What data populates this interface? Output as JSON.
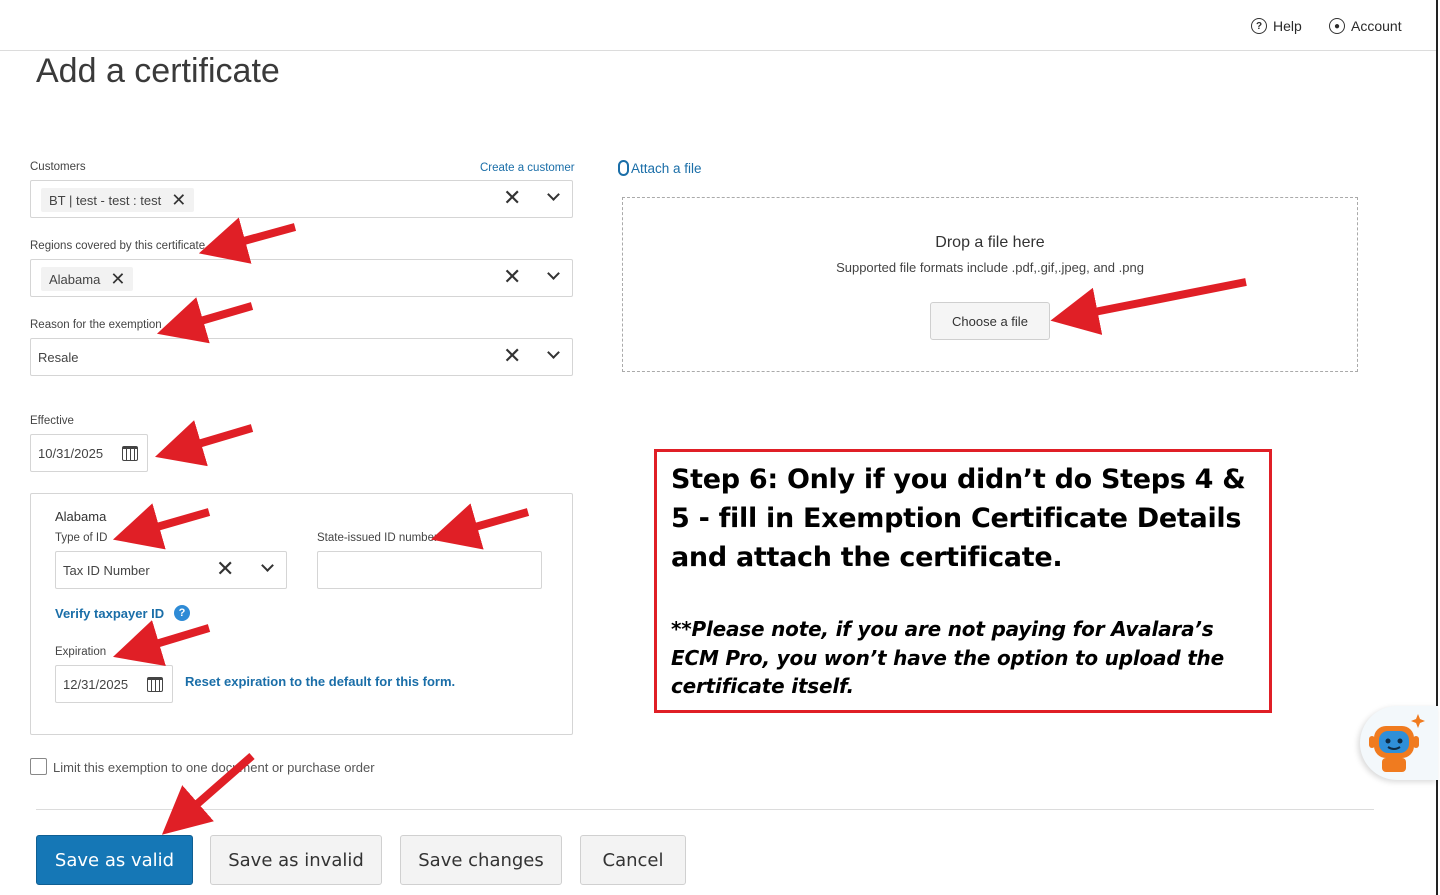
{
  "header": {
    "help_label": "Help",
    "account_label": "Account"
  },
  "page": {
    "title": "Add a certificate"
  },
  "form": {
    "customers_label": "Customers",
    "create_customer_link": "Create a customer",
    "customer_chip": "BT | test - test : test",
    "regions_label": "Regions covered by this certificate",
    "region_chip": "Alabama",
    "reason_label": "Reason for the exemption",
    "reason_value": "Resale",
    "effective_label": "Effective",
    "effective_value": "10/31/2025",
    "state_section": {
      "heading": "Alabama",
      "type_of_id_label": "Type of ID",
      "type_of_id_value": "Tax ID Number",
      "state_id_label": "State-issued ID number",
      "state_id_value": "",
      "verify_link": "Verify taxpayer ID",
      "expiration_label": "Expiration",
      "expiration_value": "12/31/2025",
      "reset_link": "Reset expiration to the default for this form."
    },
    "limit_checkbox_label": "Limit this exemption to one document or purchase order",
    "limit_checked": false
  },
  "attachment": {
    "attach_link": "Attach a file",
    "drop_title": "Drop a file here",
    "drop_sub": "Supported file formats include .pdf,.gif,.jpeg, and .png",
    "choose_button": "Choose a file"
  },
  "actions": {
    "save_valid": "Save as valid",
    "save_invalid": "Save as invalid",
    "save_changes": "Save changes",
    "cancel": "Cancel"
  },
  "callout": {
    "title": "Step 6: Only if you didn’t do Steps 4 & 5 - fill in Exemption Certificate Details and attach the certificate.",
    "note": "**Please note, if you are not paying for Avalara’s ECM Pro, you won’t have the option to upload the certificate itself."
  },
  "colors": {
    "primary": "#1577b6",
    "link": "#1a6ea8",
    "annotation_red": "#e01f26"
  },
  "icons": [
    "help-icon",
    "account-icon",
    "close-icon",
    "chevron-down-icon",
    "calendar-icon",
    "paperclip-icon",
    "help-circle-icon",
    "assistant-bot-icon"
  ]
}
